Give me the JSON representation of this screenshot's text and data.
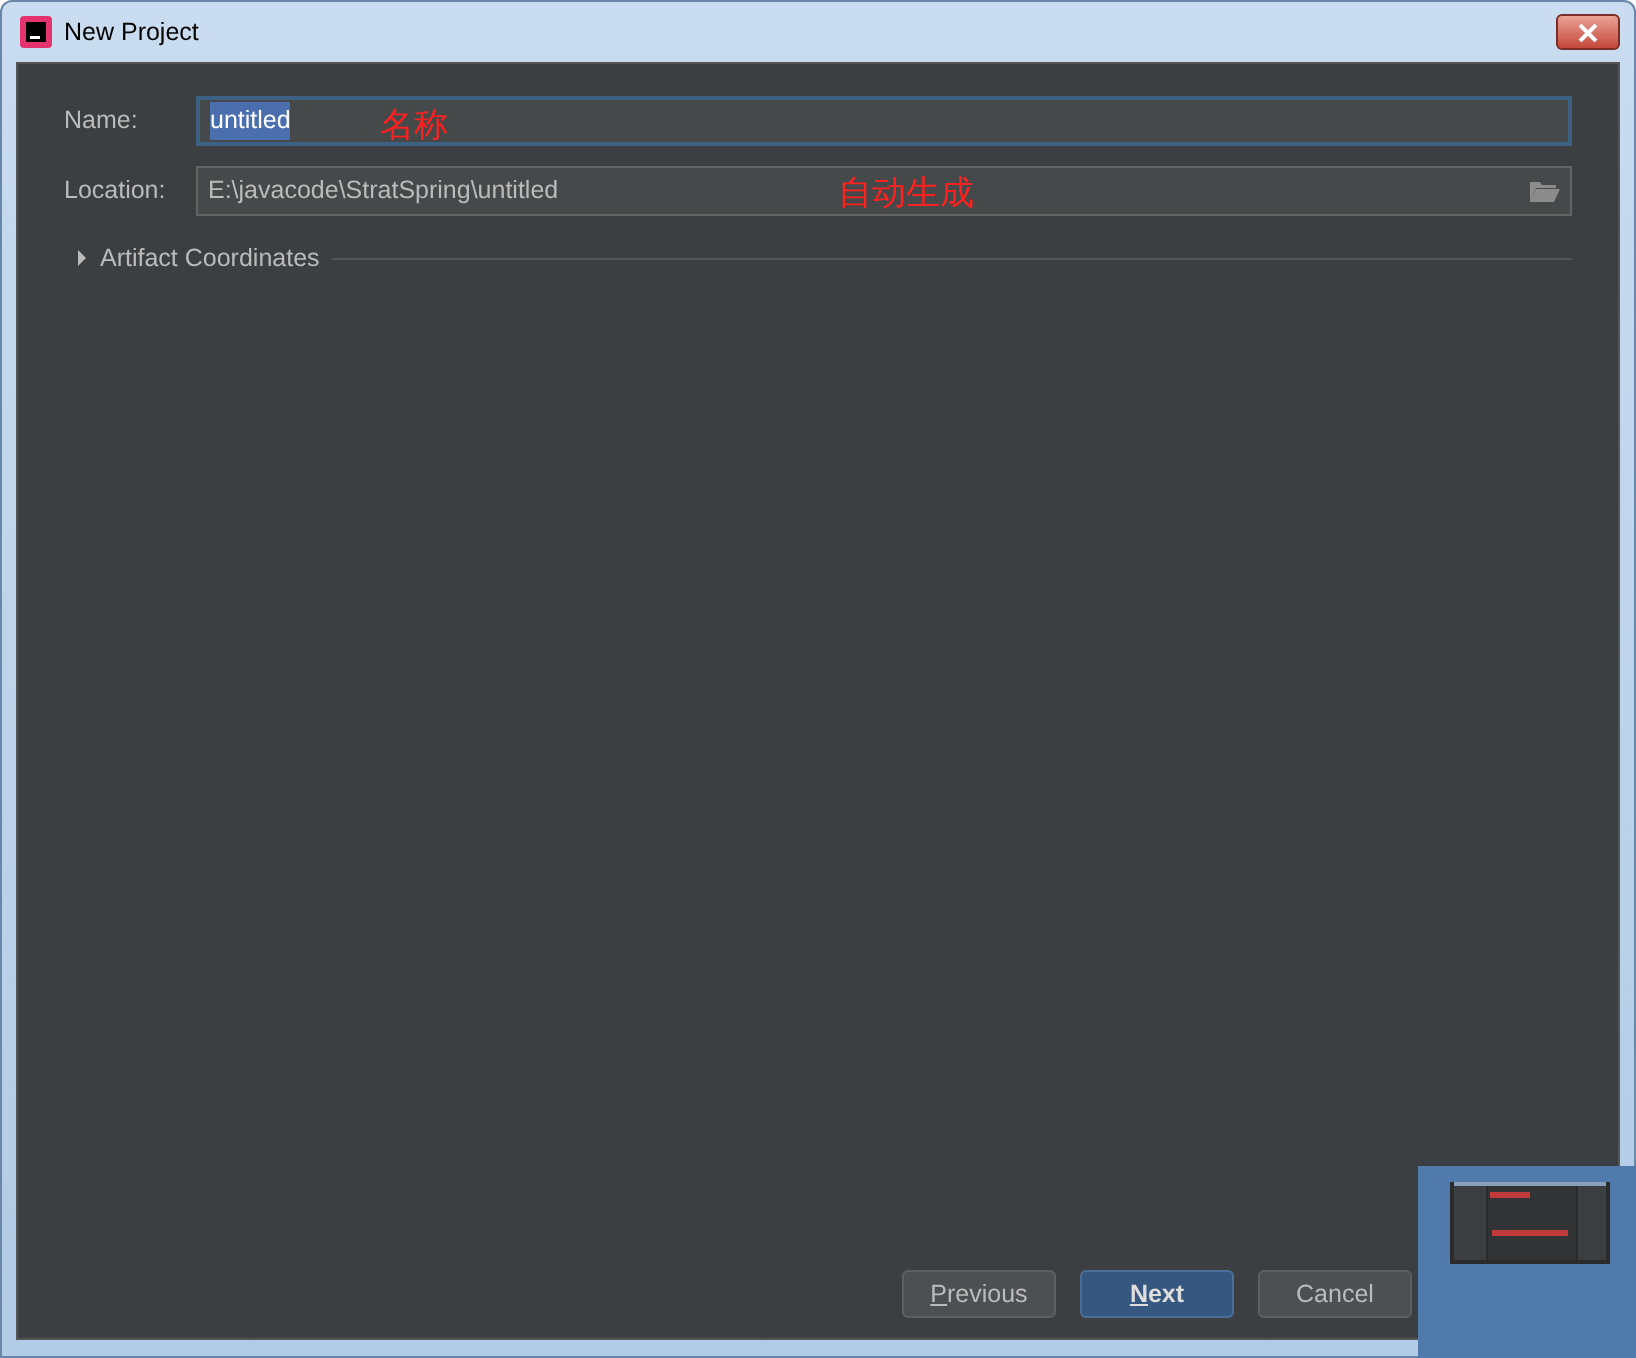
{
  "window": {
    "title": "New Project"
  },
  "fields": [
    {
      "label": "Name:",
      "value": "untitled",
      "focused": true,
      "selected_text": true,
      "kind": "text"
    },
    {
      "label": "Location:",
      "value": "E:\\javacode\\StratSpring\\untitled",
      "focused": false,
      "selected_text": false,
      "kind": "folder"
    }
  ],
  "annotations": [
    {
      "text": "名称"
    },
    {
      "text": "自动生成"
    }
  ],
  "section": {
    "label": "Artifact Coordinates",
    "expanded": false
  },
  "buttons": [
    {
      "mnemonic": "P",
      "rest": "revious",
      "default": false
    },
    {
      "mnemonic": "N",
      "rest": "ext",
      "default": true
    },
    {
      "rest": "Cancel",
      "default": false
    }
  ]
}
